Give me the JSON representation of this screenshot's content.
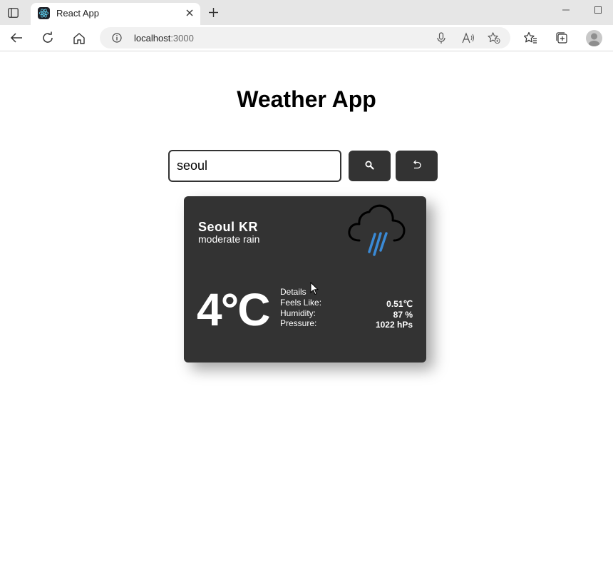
{
  "browser": {
    "tab_title": "React App",
    "address_host": "localhost",
    "address_port": ":3000"
  },
  "page": {
    "title": "Weather App",
    "search_value": "seoul"
  },
  "weather": {
    "location": "Seoul KR",
    "description": "moderate rain",
    "temperature": "4°C",
    "details_title": "Details",
    "rows": [
      {
        "label": "Feels Like:",
        "value": "0.51℃"
      },
      {
        "label": "Humidity:",
        "value": "87 %"
      },
      {
        "label": "Pressure:",
        "value": "1022 hPs"
      }
    ],
    "icon": "rain-cloud-icon"
  },
  "colors": {
    "card_bg": "#333333",
    "button_bg": "#333333",
    "rain": "#3a8ad6"
  }
}
